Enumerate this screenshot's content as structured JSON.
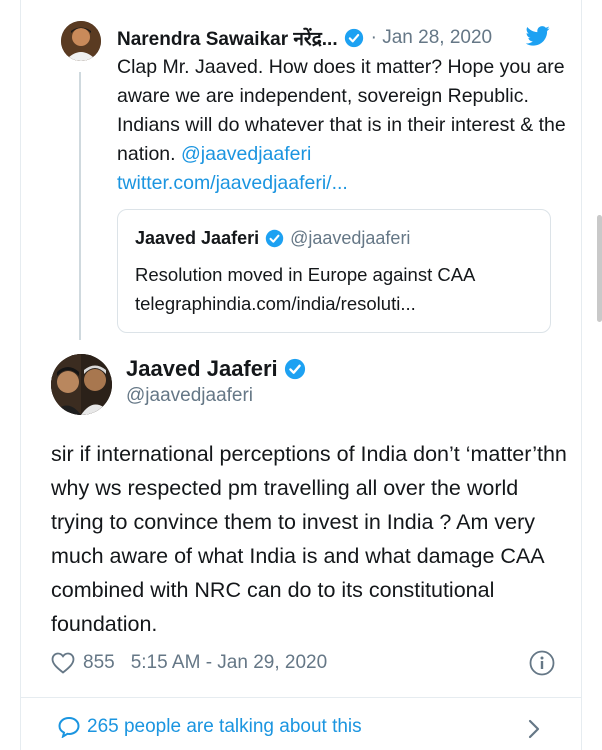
{
  "quoted_tweet": {
    "name": "Narendra Sawaikar नरेंद्र...",
    "date": "· Jan 28, 2020",
    "text_plain": "Clap Mr. Jaaved. How does it matter? Hope you are aware we are independent, sovereign Republic. Indians will do whatever that is in their interest & the nation. ",
    "mention": "@jaavedjaaferi",
    "link": "twitter.com/jaavedjaaferi/...",
    "embedded": {
      "name": "Jaaved Jaaferi",
      "handle": "@jaavedjaaferi",
      "text": "Resolution moved in Europe against CAA",
      "link": "telegraphindia.com/india/resoluti..."
    }
  },
  "main_tweet": {
    "name": "Jaaved Jaaferi",
    "handle": "@jaavedjaaferi",
    "text": "sir if international perceptions of India don’t ‘matter’thn why ws respected pm travelling all over the world trying to convince them to invest in India ? Am very much aware of what India is and what damage CAA combined with NRC can do to its constitutional foundation.",
    "likes": "855",
    "timestamp": "5:15 AM - Jan 29, 2020"
  },
  "footer": {
    "talking": "265 people are talking about this"
  },
  "colors": {
    "twitter_blue": "#1da1f2",
    "link": "#1b95e0",
    "secondary_text": "#657786"
  },
  "icons": [
    "verified-badge-icon",
    "twitter-bird-icon",
    "heart-icon",
    "info-icon",
    "comment-bubble-icon",
    "chevron-right-icon"
  ]
}
